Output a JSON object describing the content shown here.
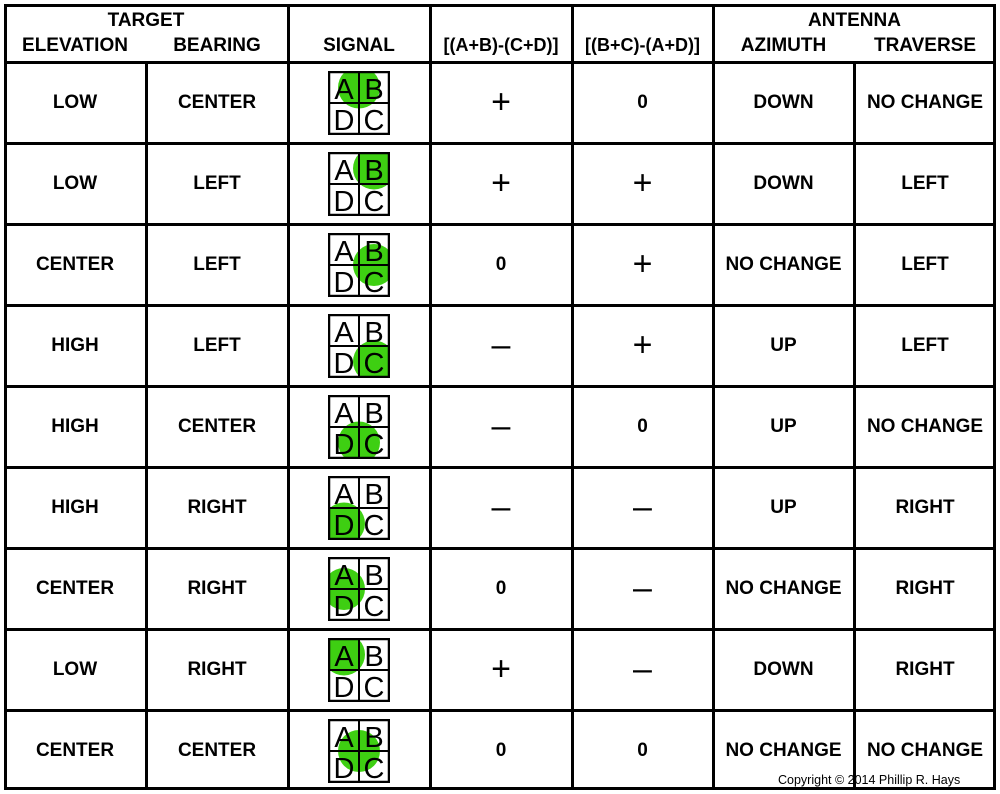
{
  "header": {
    "target_group": "TARGET",
    "elevation": "ELEVATION",
    "bearing": "BEARING",
    "signal": "SIGNAL",
    "formula_ab_cd": "[(A+B)-(C+D)]",
    "formula_bc_ad": "[(B+C)-(A+D)]",
    "antenna_group": "ANTENNA",
    "azimuth": "AZIMUTH",
    "traverse": "TRAVERSE"
  },
  "quadrant_labels": [
    "A",
    "B",
    "D",
    "C"
  ],
  "signal_color": "#3ecf12",
  "rows": [
    {
      "elevation": "LOW",
      "bearing": "CENTER",
      "signal_position": "top-center",
      "ab_cd": "+",
      "bc_ad": "0",
      "azimuth": "DOWN",
      "traverse": "NO CHANGE"
    },
    {
      "elevation": "LOW",
      "bearing": "LEFT",
      "signal_position": "top-right",
      "ab_cd": "+",
      "bc_ad": "+",
      "azimuth": "DOWN",
      "traverse": "LEFT"
    },
    {
      "elevation": "CENTER",
      "bearing": "LEFT",
      "signal_position": "middle-right",
      "ab_cd": "0",
      "bc_ad": "+",
      "azimuth": "NO CHANGE",
      "traverse": "LEFT"
    },
    {
      "elevation": "HIGH",
      "bearing": "LEFT",
      "signal_position": "bottom-right",
      "ab_cd": "–",
      "bc_ad": "+",
      "azimuth": "UP",
      "traverse": "LEFT"
    },
    {
      "elevation": "HIGH",
      "bearing": "CENTER",
      "signal_position": "bottom-center",
      "ab_cd": "–",
      "bc_ad": "0",
      "azimuth": "UP",
      "traverse": "NO CHANGE"
    },
    {
      "elevation": "HIGH",
      "bearing": "RIGHT",
      "signal_position": "bottom-left",
      "ab_cd": "–",
      "bc_ad": "–",
      "azimuth": "UP",
      "traverse": "RIGHT"
    },
    {
      "elevation": "CENTER",
      "bearing": "RIGHT",
      "signal_position": "middle-left",
      "ab_cd": "0",
      "bc_ad": "–",
      "azimuth": "NO CHANGE",
      "traverse": "RIGHT"
    },
    {
      "elevation": "LOW",
      "bearing": "RIGHT",
      "signal_position": "top-left",
      "ab_cd": "+",
      "bc_ad": "–",
      "azimuth": "DOWN",
      "traverse": "RIGHT"
    },
    {
      "elevation": "CENTER",
      "bearing": "CENTER",
      "signal_position": "center",
      "ab_cd": "0",
      "bc_ad": "0",
      "azimuth": "NO CHANGE",
      "traverse": "NO CHANGE"
    }
  ],
  "copyright": "Copyright © 2014 Phillip R. Hays"
}
